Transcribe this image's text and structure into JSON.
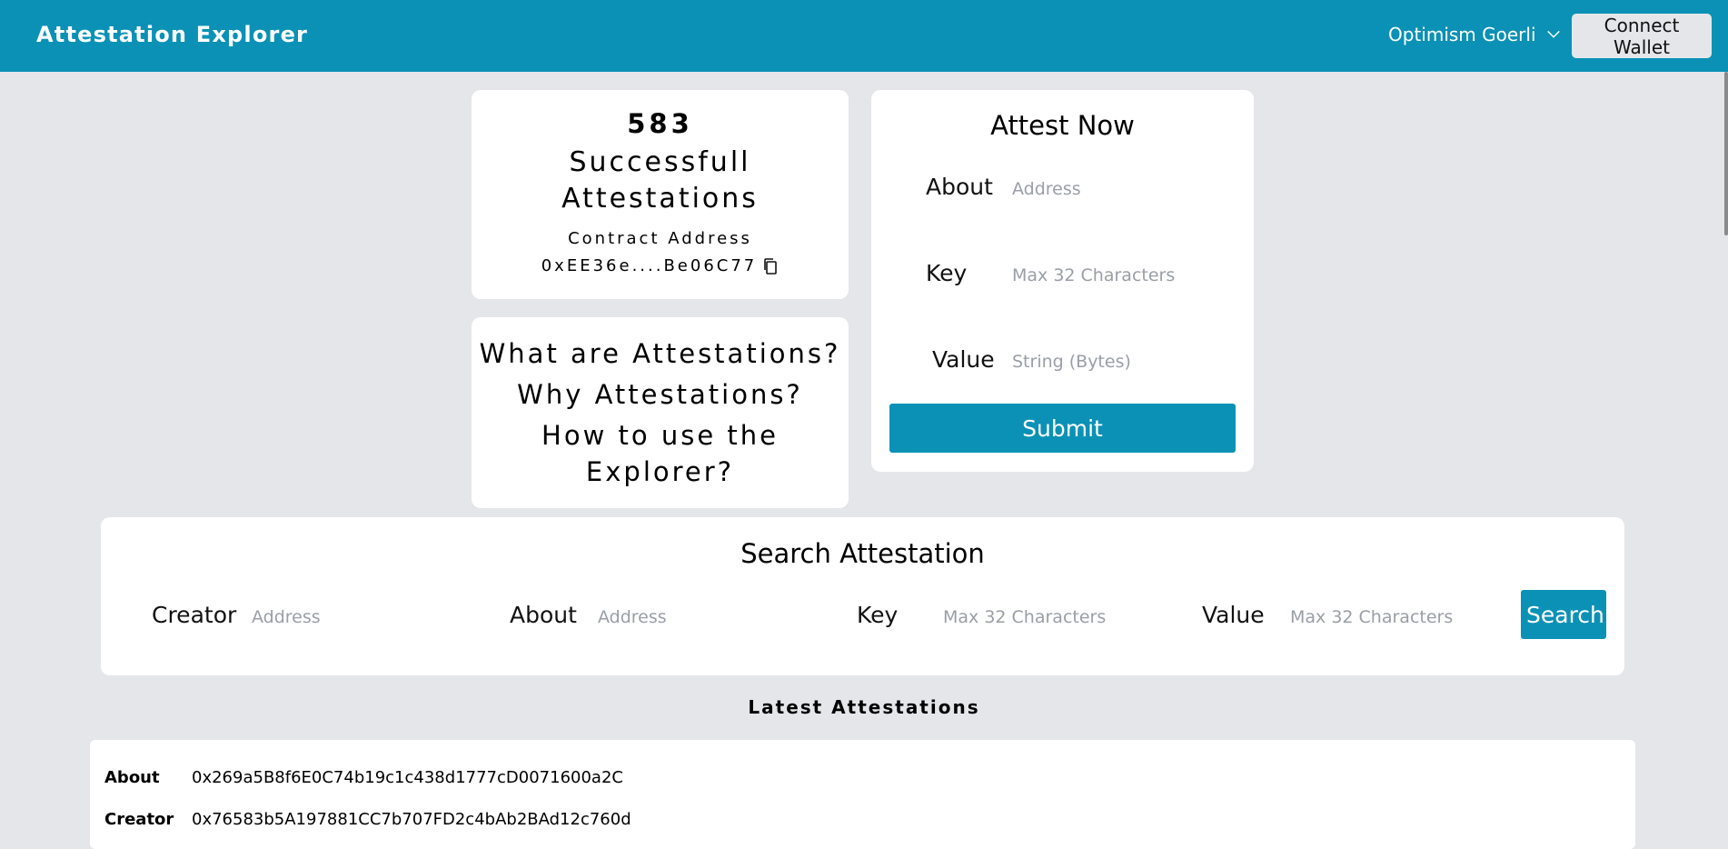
{
  "header": {
    "title": "Attestation Explorer",
    "network": "Optimism Goerli",
    "connect_label": "Connect Wallet"
  },
  "stats": {
    "count": "583",
    "label": "Successfull Attestations",
    "contract_label": "Contract Address",
    "contract_address": "0xEE36e....Be06C77"
  },
  "faq": {
    "q1": "What are Attestations?",
    "q2": "Why Attestations?",
    "q3": "How to use the Explorer?"
  },
  "attest": {
    "title": "Attest Now",
    "about_label": "About",
    "about_placeholder": "Address",
    "key_label": "Key",
    "key_placeholder": "Max 32 Characters",
    "value_label": "Value",
    "value_placeholder": "String (Bytes)",
    "submit_label": "Submit"
  },
  "search": {
    "title": "Search Attestation",
    "creator_label": "Creator",
    "creator_placeholder": "Address",
    "about_label": "About",
    "about_placeholder": "Address",
    "key_label": "Key",
    "key_placeholder": "Max 32 Characters",
    "value_label": "Value",
    "value_placeholder": "Max 32 Characters",
    "button_label": "Search"
  },
  "latest": {
    "title": "Latest Attestations",
    "about_label": "About",
    "about_value": "0x269a5B8f6E0C74b19c1c438d1777cD0071600a2C",
    "creator_label": "Creator",
    "creator_value": "0x76583b5A197881CC7b707FD2c4bAb2BAd12c760d"
  },
  "icons": {
    "network_chevron": "chevron-down-icon",
    "copy": "copy-icon"
  },
  "colors": {
    "brand": "#0b91b6",
    "background": "#e5e6ea",
    "card": "#ffffff"
  }
}
